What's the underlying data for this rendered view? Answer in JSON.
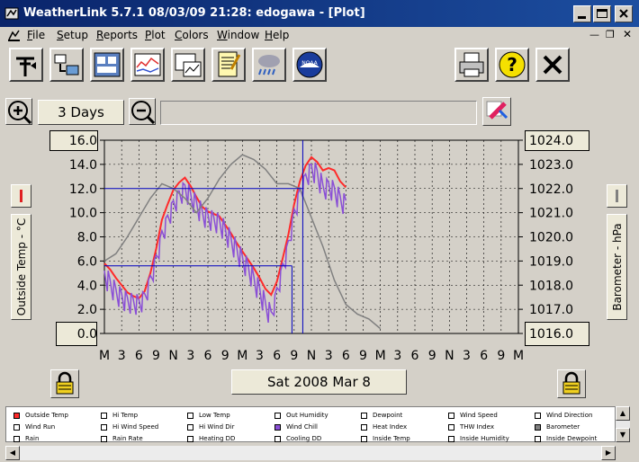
{
  "window": {
    "title": "WeatherLink 5.7.1  08/03/09  21:28: edogawa - [Plot]"
  },
  "menu": [
    "File",
    "Setup",
    "Reports",
    "Plot",
    "Colors",
    "Window",
    "Help"
  ],
  "toolbar": {
    "icons": [
      "station-icon",
      "download-icon",
      "bulletin-icon",
      "strip-chart-icon",
      "plot-icon",
      "noaa-report-icon",
      "weather-alarm-icon",
      "noaa-logo-icon",
      "print-icon",
      "help-icon",
      "close-icon"
    ]
  },
  "plot_controls": {
    "span_label": "3 Days",
    "date_label": "Sat 2008 Mar 8"
  },
  "left_axis": {
    "label": "Outside Temp - °C",
    "ticks": [
      "16.0",
      "14.0",
      "12.0",
      "10.0",
      "8.0",
      "6.0",
      "4.0",
      "2.0",
      "0.0"
    ]
  },
  "right_axis": {
    "label": "Barometer - hPa",
    "ticks": [
      "1024.0",
      "1023.0",
      "1022.0",
      "1021.0",
      "1020.0",
      "1019.0",
      "1018.0",
      "1017.0",
      "1016.0"
    ]
  },
  "x_ticks": [
    "M",
    "3",
    "6",
    "9",
    "N",
    "3",
    "6",
    "9",
    "M",
    "3",
    "6",
    "9",
    "N",
    "3",
    "6",
    "9",
    "M",
    "3",
    "6",
    "9",
    "N",
    "3",
    "6",
    "9",
    "M"
  ],
  "chart_data": {
    "type": "line",
    "xlabel": "",
    "ylim": [
      0,
      16
    ],
    "y2lim": [
      1016,
      1024
    ],
    "x_hours": [
      0,
      72
    ],
    "series": [
      {
        "color": "#ff2a2a",
        "axis": "left",
        "points": [
          [
            0,
            5.8
          ],
          [
            1,
            5.3
          ],
          [
            2,
            4.6
          ],
          [
            3,
            4.0
          ],
          [
            4,
            3.4
          ],
          [
            5,
            3.1
          ],
          [
            6,
            2.9
          ],
          [
            7,
            3.5
          ],
          [
            8,
            5.0
          ],
          [
            9,
            7.0
          ],
          [
            10,
            9.4
          ],
          [
            11,
            10.7
          ],
          [
            12,
            11.9
          ],
          [
            13,
            12.5
          ],
          [
            14,
            12.9
          ],
          [
            15,
            12.2
          ],
          [
            16,
            11.3
          ],
          [
            17,
            10.5
          ],
          [
            18,
            10.1
          ],
          [
            19,
            9.9
          ],
          [
            20,
            9.7
          ],
          [
            21,
            9.0
          ],
          [
            22,
            8.3
          ],
          [
            23,
            7.5
          ],
          [
            24,
            6.8
          ],
          [
            25,
            6.1
          ],
          [
            26,
            5.4
          ],
          [
            27,
            4.6
          ],
          [
            28,
            3.7
          ],
          [
            29,
            3.2
          ],
          [
            30,
            4.3
          ],
          [
            31,
            6.2
          ],
          [
            32,
            8.2
          ],
          [
            33,
            10.7
          ],
          [
            34,
            12.6
          ],
          [
            35,
            13.9
          ],
          [
            36,
            14.6
          ],
          [
            37,
            14.2
          ],
          [
            38,
            13.5
          ],
          [
            39,
            13.7
          ],
          [
            40,
            13.5
          ],
          [
            41,
            12.6
          ],
          [
            42,
            12.1
          ]
        ]
      },
      {
        "color": "#8a4fd6",
        "axis": "left",
        "points": [
          [
            0,
            5.2
          ],
          [
            1,
            4.4
          ],
          [
            2,
            3.7
          ],
          [
            3,
            3.3
          ],
          [
            4,
            3.0
          ],
          [
            5,
            2.9
          ],
          [
            6,
            2.8
          ],
          [
            7,
            3.3
          ],
          [
            8,
            4.8
          ],
          [
            9,
            6.5
          ],
          [
            10,
            8.5
          ],
          [
            11,
            9.8
          ],
          [
            12,
            11.0
          ],
          [
            13,
            11.8
          ],
          [
            14,
            12.3
          ],
          [
            15,
            11.6
          ],
          [
            16,
            11.0
          ],
          [
            17,
            10.2
          ],
          [
            18,
            9.9
          ],
          [
            19,
            9.7
          ],
          [
            20,
            9.5
          ],
          [
            21,
            8.8
          ],
          [
            22,
            8.0
          ],
          [
            23,
            7.2
          ],
          [
            24,
            6.4
          ],
          [
            25,
            5.7
          ],
          [
            26,
            4.7
          ],
          [
            27,
            3.8
          ],
          [
            28,
            2.6
          ],
          [
            29,
            1.8
          ],
          [
            30,
            3.8
          ],
          [
            31,
            5.8
          ],
          [
            32,
            7.7
          ],
          [
            33,
            10.3
          ],
          [
            34,
            12.0
          ],
          [
            35,
            13.2
          ],
          [
            36,
            14.0
          ],
          [
            37,
            13.5
          ],
          [
            38,
            12.3
          ],
          [
            39,
            12.5
          ],
          [
            40,
            12.1
          ],
          [
            41,
            11.4
          ],
          [
            42,
            11.0
          ]
        ]
      },
      {
        "color": "#808080",
        "axis": "right",
        "points": [
          [
            0,
            1019.0
          ],
          [
            2,
            1019.3
          ],
          [
            4,
            1020.0
          ],
          [
            6,
            1020.8
          ],
          [
            8,
            1021.6
          ],
          [
            10,
            1022.2
          ],
          [
            12,
            1022.0
          ],
          [
            14,
            1021.6
          ],
          [
            16,
            1021.0
          ],
          [
            18,
            1021.6
          ],
          [
            20,
            1022.4
          ],
          [
            22,
            1023.0
          ],
          [
            24,
            1023.4
          ],
          [
            26,
            1023.2
          ],
          [
            28,
            1022.8
          ],
          [
            30,
            1022.2
          ],
          [
            32,
            1022.2
          ],
          [
            34,
            1022.0
          ],
          [
            36,
            1020.8
          ],
          [
            38,
            1019.6
          ],
          [
            40,
            1018.2
          ],
          [
            42,
            1017.2
          ],
          [
            44,
            1016.8
          ],
          [
            46,
            1016.6
          ],
          [
            48,
            1016.2
          ]
        ]
      }
    ],
    "cursor": {
      "hour": 34.5
    }
  },
  "legend": [
    {
      "label": "Outside Temp",
      "checked": true,
      "color": "#ff2a2a"
    },
    {
      "label": "Hi Temp",
      "checked": false
    },
    {
      "label": "Low Temp",
      "checked": false
    },
    {
      "label": "Out Humidity",
      "checked": false
    },
    {
      "label": "Dewpoint",
      "checked": false
    },
    {
      "label": "Wind Speed",
      "checked": false
    },
    {
      "label": "Wind Direction",
      "checked": false
    },
    {
      "label": "Wind Run",
      "checked": false
    },
    {
      "label": "Hi Wind Speed",
      "checked": false
    },
    {
      "label": "Hi Wind Dir",
      "checked": false
    },
    {
      "label": "Wind Chill",
      "checked": true,
      "color": "#8a4fd6"
    },
    {
      "label": "Heat Index",
      "checked": false
    },
    {
      "label": "THW Index",
      "checked": false
    },
    {
      "label": "Barometer",
      "checked": true,
      "color": "#808080"
    },
    {
      "label": "Rain",
      "checked": false
    },
    {
      "label": "Rain Rate",
      "checked": false
    },
    {
      "label": "Heating DD",
      "checked": false
    },
    {
      "label": "Cooling DD",
      "checked": false
    },
    {
      "label": "Inside Temp",
      "checked": false
    },
    {
      "label": "Inside Humidity",
      "checked": false
    },
    {
      "label": "Inside Dewpoint",
      "checked": false
    }
  ]
}
